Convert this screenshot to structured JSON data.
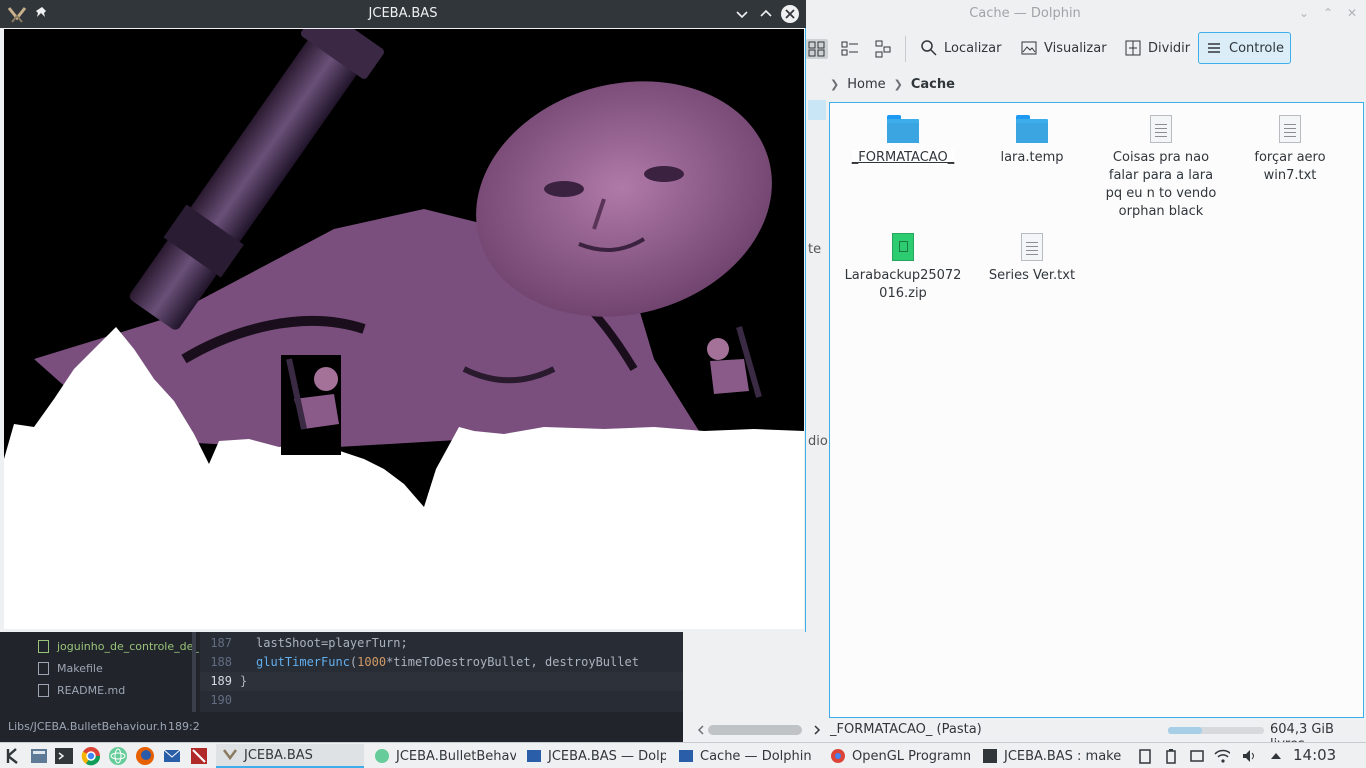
{
  "game_window": {
    "title": "JCEBA.BAS"
  },
  "dolphin": {
    "title": "Cache — Dolphin",
    "toolbar": {
      "find": "Localizar",
      "preview": "Visualizar",
      "split": "Dividir",
      "control": "Controle"
    },
    "breadcrumb": [
      "Home",
      "Cache"
    ],
    "places_fragments": [
      "te",
      "dio"
    ],
    "files": [
      {
        "name": "_FORMATACAO_",
        "type": "folder"
      },
      {
        "name": "lara.temp",
        "type": "folder"
      },
      {
        "name": "Coisas pra nao falar para a lara pq eu n to vendo orphan black",
        "type": "text"
      },
      {
        "name": "forçar aero win7.txt",
        "type": "text"
      },
      {
        "name": "Larabackup25072016.zip",
        "type": "zip"
      },
      {
        "name": "Series Ver.txt",
        "type": "text"
      }
    ],
    "status": "_FORMATACAO_ (Pasta)",
    "free_space": "604,3 GiB livres",
    "used_fraction": 0.35
  },
  "editor": {
    "tree": [
      "joguinho_de_controle_de_",
      "Makefile",
      "README.md"
    ],
    "lines": [
      {
        "n": "187",
        "code": "lastShoot=playerTurn;"
      },
      {
        "n": "188",
        "code_fn": "glutTimerFunc",
        "code_open": "(",
        "code_num": "1000",
        "code_rest": "*timeToDestroyBullet, destroyBullet"
      },
      {
        "n": "189",
        "code": "}"
      },
      {
        "n": "190",
        "code": ""
      }
    ],
    "status_path": "Libs/JCEBA.BulletBehaviour.h",
    "status_pos": "189:2"
  },
  "taskbar": {
    "tasks": [
      "JCEBA.BAS",
      "JCEBA.BulletBehav",
      "JCEBA.BAS — Dolp",
      "Cache — Dolphin",
      "OpenGL Programm",
      "JCEBA.BAS : make"
    ],
    "clock": "14:03"
  },
  "colors": {
    "accent": "#3daee9",
    "titlebar_dark": "#31363b",
    "skin_purple": "#7a4f7e",
    "terrain": "#ffffff"
  }
}
